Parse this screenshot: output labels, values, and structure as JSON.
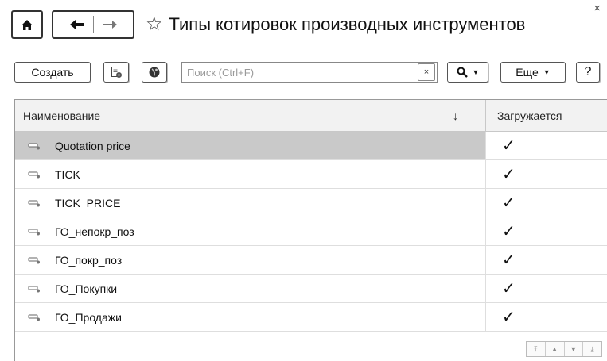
{
  "window": {
    "title": "Типы котировок производных инструментов",
    "close_glyph": "×"
  },
  "nav": {
    "home_icon": "home-icon",
    "back_icon": "arrow-left-icon",
    "forward_icon": "arrow-right-icon",
    "favorite_icon": "star-outline-icon"
  },
  "toolbar": {
    "create_label": "Создать",
    "doc_icon": "document-copy-icon",
    "globe_icon": "globe-icon",
    "search_placeholder": "Поиск (Ctrl+F)",
    "search_value": "",
    "search_clear": "×",
    "find_icon": "magnifier-icon",
    "more_label": "Еще",
    "help_label": "?"
  },
  "table": {
    "columns": {
      "name": "Наименование",
      "sort_indicator": "↓",
      "loaded": "Загружается"
    },
    "rows": [
      {
        "name": "Quotation price",
        "loaded": "✓",
        "selected": true
      },
      {
        "name": "TICK",
        "loaded": "✓",
        "selected": false
      },
      {
        "name": "TICK_PRICE",
        "loaded": "✓",
        "selected": false
      },
      {
        "name": "ГО_непокр_поз",
        "loaded": "✓",
        "selected": false
      },
      {
        "name": "ГО_покр_поз",
        "loaded": "✓",
        "selected": false
      },
      {
        "name": "ГО_Покупки",
        "loaded": "✓",
        "selected": false
      },
      {
        "name": "ГО_Продажи",
        "loaded": "✓",
        "selected": false
      }
    ]
  },
  "scroll": {
    "first": "⤒",
    "up": "▲",
    "down": "▼",
    "last": "⤓"
  }
}
